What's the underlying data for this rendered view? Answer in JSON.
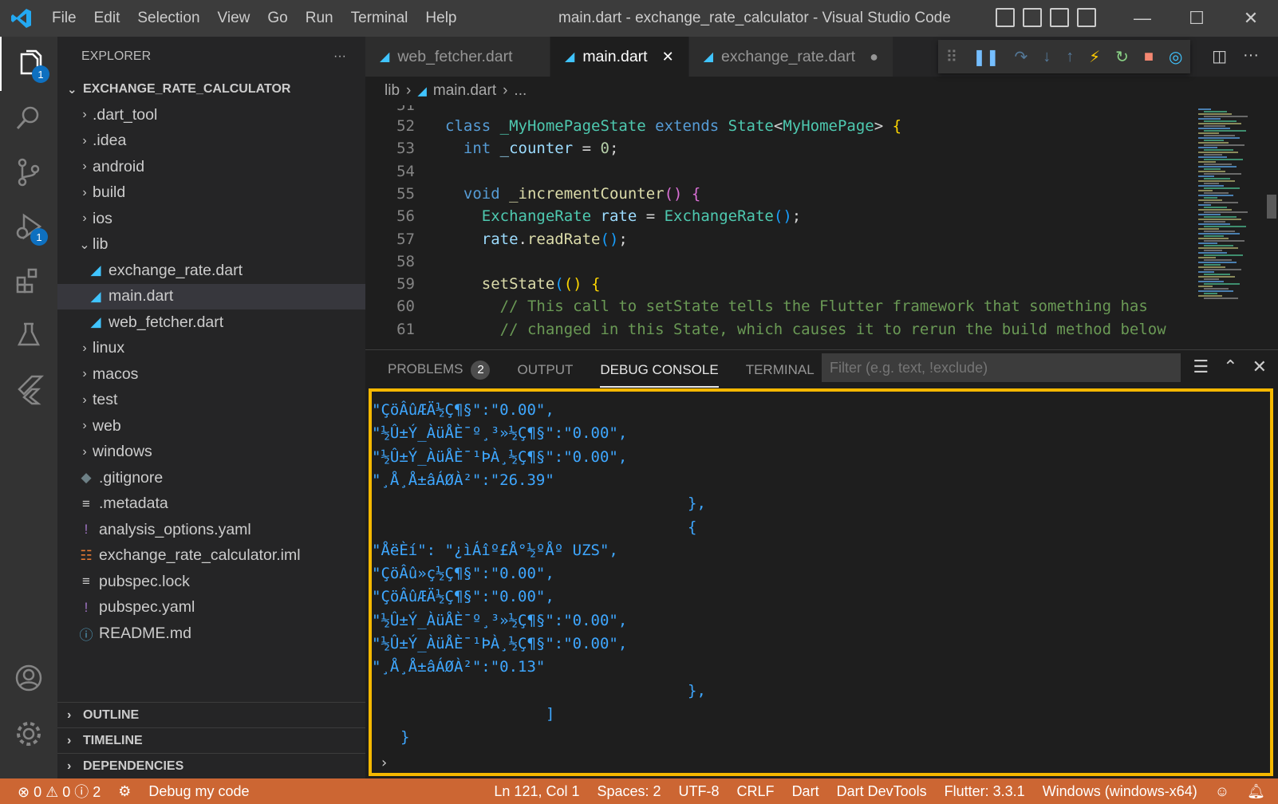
{
  "window": {
    "title": "main.dart - exchange_rate_calculator - Visual Studio Code",
    "menu": [
      "File",
      "Edit",
      "Selection",
      "View",
      "Go",
      "Run",
      "Terminal",
      "Help"
    ]
  },
  "activity": {
    "explorer_badge": "1",
    "debug_badge": "1"
  },
  "sidebar": {
    "header": "EXPLORER",
    "more": "···",
    "project": "EXCHANGE_RATE_CALCULATOR",
    "tree": [
      {
        "name": ".dart_tool",
        "chev": "›",
        "icon": "",
        "indent": 0
      },
      {
        "name": ".idea",
        "chev": "›",
        "icon": "",
        "indent": 0
      },
      {
        "name": "android",
        "chev": "›",
        "icon": "",
        "indent": 0
      },
      {
        "name": "build",
        "chev": "›",
        "icon": "",
        "indent": 0
      },
      {
        "name": "ios",
        "chev": "›",
        "icon": "",
        "indent": 0
      },
      {
        "name": "lib",
        "chev": "⌄",
        "icon": "",
        "indent": 0
      },
      {
        "name": "exchange_rate.dart",
        "chev": "",
        "icon": "◢",
        "indent": 1
      },
      {
        "name": "main.dart",
        "chev": "",
        "icon": "◢",
        "indent": 1
      },
      {
        "name": "web_fetcher.dart",
        "chev": "",
        "icon": "◢",
        "indent": 1
      },
      {
        "name": "linux",
        "chev": "›",
        "icon": "",
        "indent": 0
      },
      {
        "name": "macos",
        "chev": "›",
        "icon": "",
        "indent": 0
      },
      {
        "name": "test",
        "chev": "›",
        "icon": "",
        "indent": 0
      },
      {
        "name": "web",
        "chev": "›",
        "icon": "",
        "indent": 0
      },
      {
        "name": "windows",
        "chev": "›",
        "icon": "",
        "indent": 0
      },
      {
        "name": ".gitignore",
        "chev": "",
        "icon": "◆",
        "indent": 0
      },
      {
        "name": ".metadata",
        "chev": "",
        "icon": "≡",
        "indent": 0
      },
      {
        "name": "analysis_options.yaml",
        "chev": "",
        "icon": "!",
        "indent": 0
      },
      {
        "name": "exchange_rate_calculator.iml",
        "chev": "",
        "icon": "☷",
        "indent": 0
      },
      {
        "name": "pubspec.lock",
        "chev": "",
        "icon": "≡",
        "indent": 0
      },
      {
        "name": "pubspec.yaml",
        "chev": "",
        "icon": "!",
        "indent": 0
      },
      {
        "name": "README.md",
        "chev": "",
        "icon": "ⓘ",
        "indent": 0
      }
    ],
    "sections": [
      "OUTLINE",
      "TIMELINE",
      "DEPENDENCIES"
    ]
  },
  "tabs": [
    {
      "label": "web_fetcher.dart",
      "end": "",
      "active": false
    },
    {
      "label": "main.dart",
      "end": "✕",
      "active": true
    },
    {
      "label": "exchange_rate.dart",
      "end": "●",
      "active": false
    }
  ],
  "breadcrumb": {
    "folder": "lib",
    "file": "main.dart",
    "more": "..."
  },
  "code": {
    "first_partial": "51",
    "lines": [
      {
        "n": "52",
        "html": "<span class='kw'>class</span> <span class='ty'>_MyHomePageState</span> <span class='kw'>extends</span> <span class='ty'>State</span>&lt;<span class='ty'>MyHomePage</span>&gt; <span class='br1'>{</span>"
      },
      {
        "n": "53",
        "html": "  <span class='kw'>int</span> <span class='vr'>_counter</span> = <span class='nm'>0</span>;"
      },
      {
        "n": "54",
        "html": ""
      },
      {
        "n": "55",
        "html": "  <span class='kw'>void</span> <span class='fn'>_incrementCounter</span><span class='br2'>()</span> <span class='br2'>{</span>"
      },
      {
        "n": "56",
        "html": "    <span class='ty'>ExchangeRate</span> <span class='vr'>rate</span> = <span class='ty'>ExchangeRate</span><span class='br3'>()</span>;"
      },
      {
        "n": "57",
        "html": "    <span class='vr'>rate</span>.<span class='fn'>readRate</span><span class='br3'>()</span>;"
      },
      {
        "n": "58",
        "html": ""
      },
      {
        "n": "59",
        "html": "    <span class='fn'>setState</span><span class='br3'>(</span><span class='br1'>()</span> <span class='br1'>{</span>"
      },
      {
        "n": "60",
        "html": "      <span class='cm'>// This call to setState tells the Flutter framework that something has</span>"
      },
      {
        "n": "61",
        "html": "      <span class='cm'>// changed in this State, which causes it to rerun the build method below</span>"
      }
    ]
  },
  "panel": {
    "tabs": [
      {
        "label": "PROBLEMS",
        "count": "2",
        "active": false
      },
      {
        "label": "OUTPUT",
        "count": "",
        "active": false
      },
      {
        "label": "DEBUG CONSOLE",
        "count": "",
        "active": true
      },
      {
        "label": "TERMINAL",
        "count": "",
        "active": false
      }
    ],
    "filter_placeholder": "Filter (e.g. text, !exclude)",
    "console_lines": [
      {
        "indent": 4,
        "text": "\"ÇöÂûÆÄ½Ç¶§\":\"0.00\","
      },
      {
        "indent": 4,
        "text": "\"½Û±Ý_ÀüÅÈ¯º¸³»½Ç¶§\":\"0.00\","
      },
      {
        "indent": 4,
        "text": "\"½Û±Ý_ÀüÅÈ¯¹ÞÀ¸½Ç¶§\":\"0.00\","
      },
      {
        "indent": 4,
        "text": "\"¸Å¸Å±âÁØÀ²\":\"26.39\""
      },
      {
        "indent": 3,
        "text": "},"
      },
      {
        "indent": 3,
        "text": "{"
      },
      {
        "indent": 4,
        "text": "\"ÅëÈ­í\": \"¿ìÁîº£Å°½ºÅº UZS\","
      },
      {
        "indent": 4,
        "text": "\"ÇöÂû»ç½Ç¶§\":\"0.00\","
      },
      {
        "indent": 4,
        "text": "\"ÇöÂûÆÄ½Ç¶§\":\"0.00\","
      },
      {
        "indent": 4,
        "text": "\"½Û±Ý_ÀüÅÈ¯º¸³»½Ç¶§\":\"0.00\","
      },
      {
        "indent": 4,
        "text": "\"½Û±Ý_ÀüÅÈ¯¹ÞÀ¸½Ç¶§\":\"0.00\","
      },
      {
        "indent": 4,
        "text": "\"¸Å¸Å±âÁØÀ²\":\"0.13\""
      },
      {
        "indent": 3,
        "text": "},"
      },
      {
        "indent": 2,
        "text": "]"
      },
      {
        "indent": 0,
        "text": "}"
      }
    ],
    "prompt": "›"
  },
  "status": {
    "problems": "⊗ 0 ⚠ 0 ⓘ 2",
    "debug": "Debug my code",
    "position": "Ln 121, Col 1",
    "spaces": "Spaces: 2",
    "encoding": "UTF-8",
    "eol": "CRLF",
    "language": "Dart",
    "devtools": "Dart DevTools",
    "flutter": "Flutter: 3.3.1",
    "device": "Windows (windows-x64)",
    "colors": {
      "bar": "#cc6633"
    }
  }
}
